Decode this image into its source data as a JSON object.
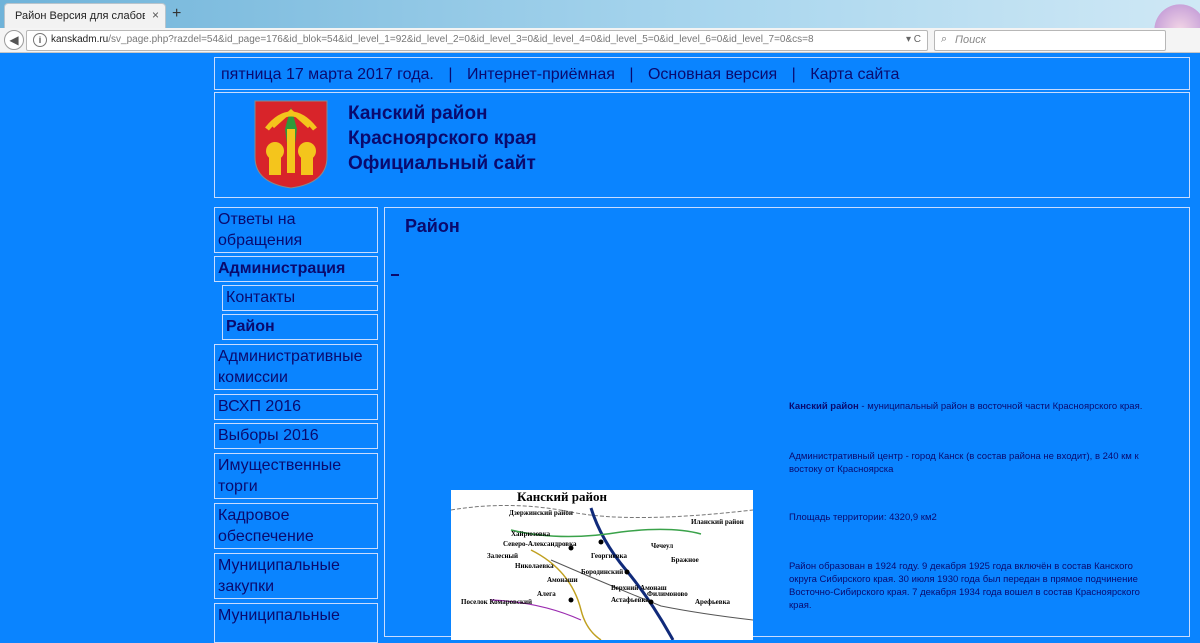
{
  "browser": {
    "tab_title": "Район Версия для слабовидя...",
    "tab_close": "×",
    "new_tab": "+",
    "url_domain": "kanskadm.ru",
    "url_rest": "/sv_page.php?razdel=54&id_page=176&id_blok=54&id_level_1=92&id_level_2=0&id_level_3=0&id_level_4=0&id_level_5=0&id_level_6=0&id_level_7=0&cs=8",
    "url_controls": "▾ C",
    "search_placeholder": "Поиск"
  },
  "topline": {
    "date": "пятница 17 марта 2017 года.",
    "sep1": "|",
    "reception": "Интернет-приёмная",
    "sep2": "|",
    "main_version": "Основная версия",
    "sep3": "|",
    "sitemap": "Карта сайта"
  },
  "header": {
    "title_line1": "Канский район",
    "title_line2": "Красноярского края",
    "title_line3": "Официальный сайт"
  },
  "menu": [
    {
      "label": "Ответы на обращения"
    },
    {
      "label": "Администрация"
    },
    {
      "label": "Контакты"
    },
    {
      "label": "Район"
    },
    {
      "label": "Административные комиссии"
    },
    {
      "label": "ВСХП 2016"
    },
    {
      "label": "Выборы 2016"
    },
    {
      "label": "Имущественные торги"
    },
    {
      "label": "Кадровое обеспечение"
    },
    {
      "label": "Муниципальные закупки"
    },
    {
      "label": "Муниципальные"
    }
  ],
  "content": {
    "title": "Район",
    "p1_bold": "Канский район",
    "p1_rest": " - муниципальный район в восточной части Красноярского края.",
    "p2": "Административный центр - город Канск (в состав района не входит), в 240 км к востоку от Красноярска",
    "p3": "Площадь территории: 4320,9 км2",
    "p4": "Район образован в 1924 году. 9 декабря 1925 года включён в состав Канского округа Сибирского края. 30 июля 1930 года был передан в прямое подчинение Восточно-Сибирского края. 7 декабря 1934 года вошел в состав Красноярского края."
  },
  "map": {
    "title": "Канский район",
    "labels": [
      "Дзержинский район",
      "Иланский район",
      "Хайрюзовка",
      "Северо-Александровка",
      "Чечеул",
      "Залесный",
      "Бражное",
      "Николаевка",
      "Георгиевка",
      "Бородинский",
      "Амонаши",
      "Верхний Амонаш",
      "Филимоново",
      "Астафьевка",
      "Алега",
      "Арефьевка",
      "Поселок Комаровский"
    ]
  }
}
